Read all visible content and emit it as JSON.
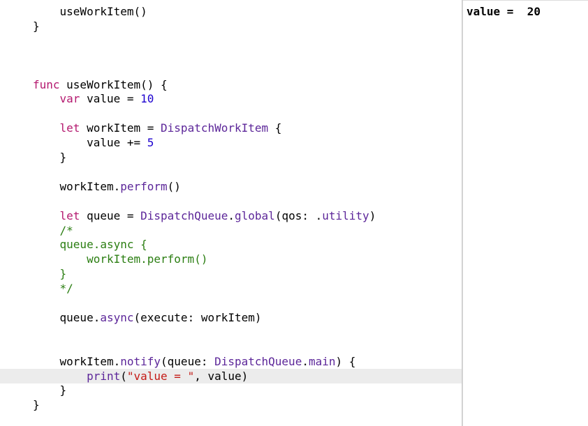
{
  "editor": {
    "colors": {
      "plain": "#000000",
      "keyword": "#b4196f",
      "number": "#1c00cf",
      "type": "#5c2699",
      "member": "#5c2699",
      "comment": "#2b7e12",
      "string": "#c41a16",
      "current_line_highlight": "#ececec"
    },
    "lines": [
      {
        "tokens": [
          {
            "t": "    useWorkItem()",
            "k": "plain"
          }
        ]
      },
      {
        "tokens": [
          {
            "t": "}",
            "k": "plain"
          }
        ]
      },
      {
        "tokens": []
      },
      {
        "tokens": []
      },
      {
        "tokens": []
      },
      {
        "tokens": [
          {
            "t": "func",
            "k": "kw"
          },
          {
            "t": " useWorkItem() {",
            "k": "plain"
          }
        ]
      },
      {
        "tokens": [
          {
            "t": "    ",
            "k": "plain"
          },
          {
            "t": "var",
            "k": "kw"
          },
          {
            "t": " value = ",
            "k": "plain"
          },
          {
            "t": "10",
            "k": "num"
          }
        ]
      },
      {
        "tokens": []
      },
      {
        "tokens": [
          {
            "t": "    ",
            "k": "plain"
          },
          {
            "t": "let",
            "k": "kw"
          },
          {
            "t": " workItem = ",
            "k": "plain"
          },
          {
            "t": "DispatchWorkItem",
            "k": "type"
          },
          {
            "t": " {",
            "k": "plain"
          }
        ]
      },
      {
        "tokens": [
          {
            "t": "        value += ",
            "k": "plain"
          },
          {
            "t": "5",
            "k": "num"
          }
        ]
      },
      {
        "tokens": [
          {
            "t": "    }",
            "k": "plain"
          }
        ]
      },
      {
        "tokens": []
      },
      {
        "tokens": [
          {
            "t": "    workItem.",
            "k": "plain"
          },
          {
            "t": "perform",
            "k": "member"
          },
          {
            "t": "()",
            "k": "plain"
          }
        ]
      },
      {
        "tokens": []
      },
      {
        "tokens": [
          {
            "t": "    ",
            "k": "plain"
          },
          {
            "t": "let",
            "k": "kw"
          },
          {
            "t": " queue = ",
            "k": "plain"
          },
          {
            "t": "DispatchQueue",
            "k": "type"
          },
          {
            "t": ".",
            "k": "plain"
          },
          {
            "t": "global",
            "k": "member"
          },
          {
            "t": "(qos: .",
            "k": "plain"
          },
          {
            "t": "utility",
            "k": "member"
          },
          {
            "t": ")",
            "k": "plain"
          }
        ]
      },
      {
        "tokens": [
          {
            "t": "    /*",
            "k": "comment"
          }
        ]
      },
      {
        "tokens": [
          {
            "t": "    queue.async {",
            "k": "comment"
          }
        ]
      },
      {
        "tokens": [
          {
            "t": "        workItem.perform()",
            "k": "comment"
          }
        ]
      },
      {
        "tokens": [
          {
            "t": "    }",
            "k": "comment"
          }
        ]
      },
      {
        "tokens": [
          {
            "t": "    */",
            "k": "comment"
          }
        ]
      },
      {
        "tokens": []
      },
      {
        "tokens": [
          {
            "t": "    queue.",
            "k": "plain"
          },
          {
            "t": "async",
            "k": "member"
          },
          {
            "t": "(execute: workItem)",
            "k": "plain"
          }
        ]
      },
      {
        "tokens": []
      },
      {
        "tokens": []
      },
      {
        "tokens": [
          {
            "t": "    workItem.",
            "k": "plain"
          },
          {
            "t": "notify",
            "k": "member"
          },
          {
            "t": "(queue: ",
            "k": "plain"
          },
          {
            "t": "DispatchQueue",
            "k": "type"
          },
          {
            "t": ".",
            "k": "plain"
          },
          {
            "t": "main",
            "k": "member"
          },
          {
            "t": ") {",
            "k": "plain"
          }
        ]
      },
      {
        "highlighted": true,
        "tokens": [
          {
            "t": "        ",
            "k": "plain"
          },
          {
            "t": "print",
            "k": "member"
          },
          {
            "t": "(",
            "k": "plain"
          },
          {
            "t": "\"value = \"",
            "k": "string"
          },
          {
            "t": ", value)",
            "k": "plain"
          }
        ]
      },
      {
        "tokens": [
          {
            "t": "    }",
            "k": "plain"
          }
        ]
      },
      {
        "tokens": [
          {
            "t": "}",
            "k": "plain"
          }
        ]
      }
    ]
  },
  "console": {
    "output": "value =  20"
  }
}
